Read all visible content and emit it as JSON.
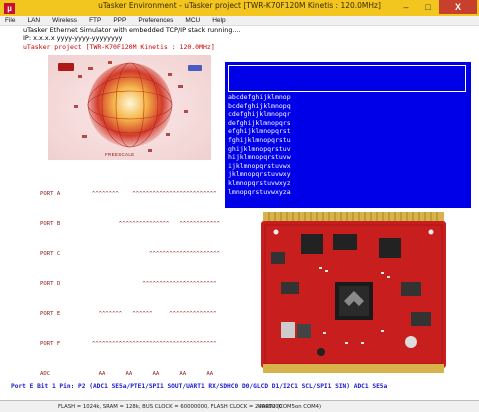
{
  "window": {
    "title": "uTasker Environment - uTasker project [TWR-K70F120M Kinetis : 120.0MHz]",
    "close_glyph": "X",
    "minimize_glyph": "–",
    "maximize_glyph": "□"
  },
  "menu": {
    "items": [
      "File",
      "LAN",
      "Wireless",
      "FTP",
      "PPP",
      "Preferences",
      "MCU",
      "Help"
    ]
  },
  "header": {
    "line1": "uTasker Ethernet Simulator with embedded TCP/IP stack running....",
    "line2": "IP: x.x.x.x   yyyy-yyyy-yyyyyyyy",
    "line3": "uTasker project [TWR-K70F120M Kinetis : 120.0MHz]"
  },
  "sphere": {
    "caption": "FREESCALE"
  },
  "lcd": {
    "lines": [
      "abcdefghijklmnop",
      "bcdefghijklmnopq",
      "cdefghijklmnopqr",
      "defghijklmnopqrs",
      "efghijklmnopqrst",
      "fghijklmnopqrstu",
      "ghijklmnopqrstuv",
      "hijklmnopqrstuvw",
      "ijklmnopqrstuvwx",
      "jklmnopqrstuvwxy",
      "klmnopqrstuvwxyz",
      "lmnopqrstuvwxyza"
    ]
  },
  "ports": [
    {
      "name": "PORT A",
      "bits": "     ^^^^^^^^    ^^^^^^^^^^^^^^^^^^^^^^^^^"
    },
    {
      "name": "PORT B",
      "bits": "             ^^^^^^^^^^^^^^^   ^^^^^^^^^^^^"
    },
    {
      "name": "PORT C",
      "bits": "                      ^^^^^^^^^^^^^^^^^^^^^"
    },
    {
      "name": "PORT D",
      "bits": "                    ^^^^^^^^^^^^^^^^^^^^^^"
    },
    {
      "name": "PORT E",
      "bits": "       ^^^^^^^   ^^^^^^     ^^^^^^^^^^^^^^"
    },
    {
      "name": "PORT F",
      "bits": "     ^^^^^^^^^^^^^^^^^^^^^^^^^^^^^^^^^^^^^"
    },
    {
      "name": "ADC",
      "bits": "       AA      AA      AA      AA      AA"
    }
  ],
  "pin_info": "Port E Bit 1 Pin: P2 (ADC1 SE5a/PTE1/SPI1 SOUT/UART1 RX/SDHC0 D0/GLCD D1/I2C1 SCL/SPI1 SIN) ADC1 SE5a",
  "status": {
    "left": "FLASH = 1024k, SRAM = 128k, BUS CLOCK = 60000000, FLASH CLOCK = 24000000",
    "right": "UART2 (COM5on COM4)"
  },
  "colors": {
    "titlebar": "#f3c51f",
    "lcd_background": "#0000e8",
    "port_text": "#8b1a1a",
    "header_red": "#cc0000",
    "pin_info_blue": "#1a1acc",
    "board_red": "#c81e1e"
  }
}
